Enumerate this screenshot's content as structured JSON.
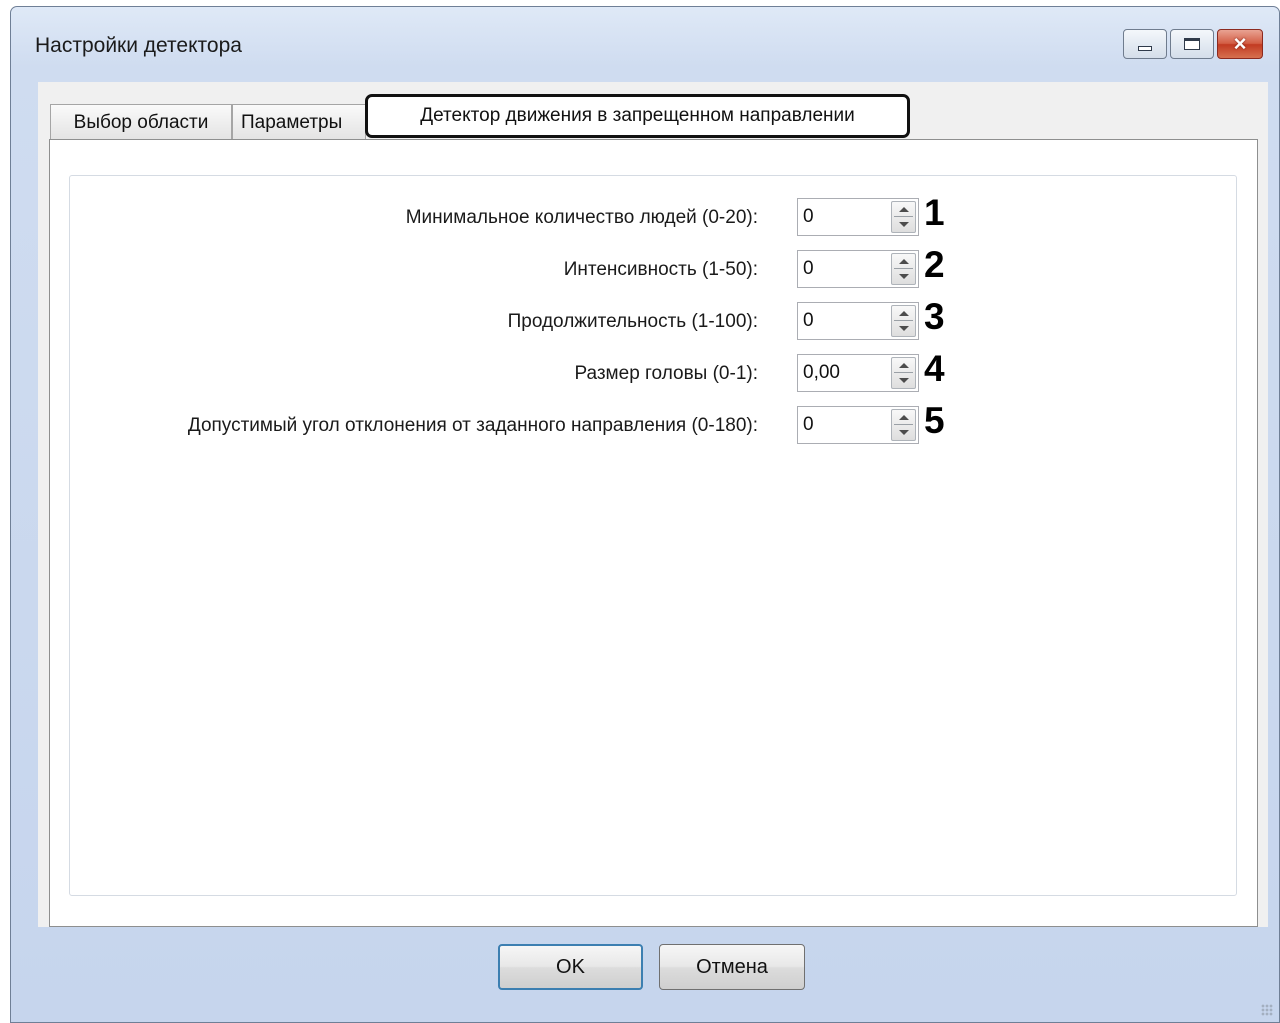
{
  "window": {
    "title": "Настройки детектора"
  },
  "tabs": [
    {
      "label": "Выбор области"
    },
    {
      "label": "Параметры"
    },
    {
      "label": "Детектор движения в запрещенном направлении",
      "active": true
    }
  ],
  "fields": [
    {
      "label": "Минимальное количество людей (0-20):",
      "value": "0",
      "marker": "1"
    },
    {
      "label": "Интенсивность (1-50):",
      "value": "0",
      "marker": "2"
    },
    {
      "label": "Продолжительность (1-100):",
      "value": "0",
      "marker": "3"
    },
    {
      "label": "Размер головы (0-1):",
      "value": "0,00",
      "marker": "4"
    },
    {
      "label": "Допустимый угол отклонения от заданного направления (0-180):",
      "value": "0",
      "marker": "5"
    }
  ],
  "buttons": {
    "ok": "OK",
    "cancel": "Отмена"
  }
}
